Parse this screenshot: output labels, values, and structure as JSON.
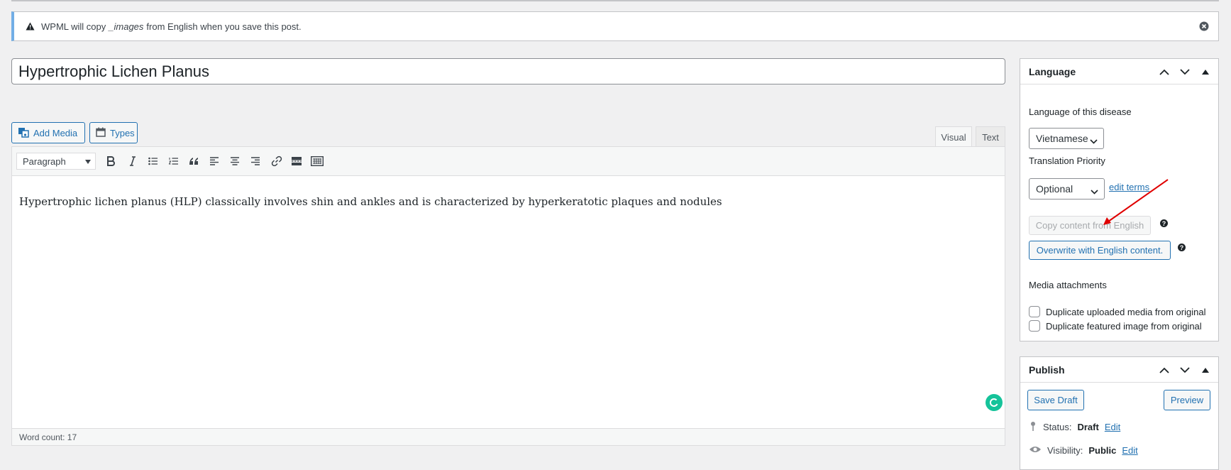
{
  "notice": {
    "text_before": "WPML will copy",
    "field": "_images",
    "text_after": "from English when you save this post."
  },
  "post": {
    "title": "Hypertrophic Lichen Planus",
    "content": "Hypertrophic lichen planus (HLP) classically involves shin and ankles and is characterized by hyperkeratotic plaques and nodules",
    "word_count": "Word count: 17"
  },
  "media_buttons": {
    "add_media": "Add Media",
    "types": "Types"
  },
  "editor_tabs": {
    "visual": "Visual",
    "text": "Text"
  },
  "toolbar": {
    "format": "Paragraph"
  },
  "language_box": {
    "title": "Language",
    "language_label": "Language of this disease",
    "language_value": "Vietnamese",
    "priority_label": "Translation Priority",
    "priority_value": "Optional",
    "edit_terms": "edit terms",
    "copy_btn": "Copy content from English",
    "overwrite_btn": "Overwrite with English content.",
    "help": "?",
    "media_label": "Media attachments",
    "dup_media": "Duplicate uploaded media from original",
    "dup_featured": "Duplicate featured image from original"
  },
  "publish_box": {
    "title": "Publish",
    "save_draft": "Save Draft",
    "preview": "Preview",
    "status_label": "Status:",
    "status_value": "Draft",
    "visibility_label": "Visibility:",
    "visibility_value": "Public",
    "edit": "Edit"
  },
  "colors": {
    "accent": "#2271b1",
    "annotation_arrow": "#e00000",
    "grammarly": "#15c39a"
  }
}
